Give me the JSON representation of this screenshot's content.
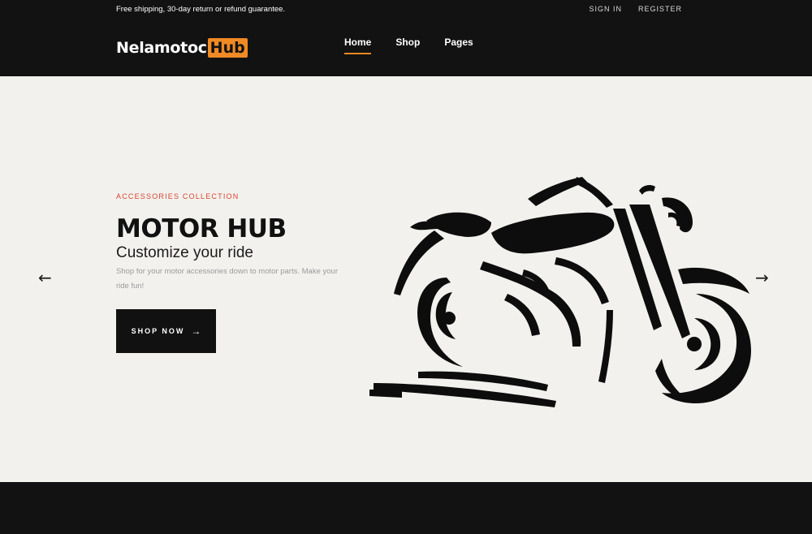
{
  "topbar": {
    "promo": "Free shipping, 30-day return or refund guarantee.",
    "sign_in": "SIGN IN",
    "register": "REGISTER"
  },
  "logo": {
    "main": "Nelamotoc",
    "accent": "Hub"
  },
  "nav": {
    "items": [
      "Home",
      "Shop",
      "Pages"
    ],
    "active": "Home"
  },
  "hero": {
    "eyebrow": "ACCESSORIES COLLECTION",
    "title": "MOTOR HUB",
    "subtitle": "Customize your ride",
    "description": "Shop for your motor accessories down to motor parts. Make your ride fun!",
    "cta_label": "SHOP NOW",
    "cta_icon": "arrow-right-icon",
    "image": "motorcycle-silhouette",
    "prev_icon": "arrow-left-icon",
    "next_icon": "arrow-right-icon"
  },
  "colors": {
    "accent": "#f08a24",
    "eyebrow": "#d9442d",
    "dark": "#121212",
    "hero_bg": "#f2f1ee"
  }
}
